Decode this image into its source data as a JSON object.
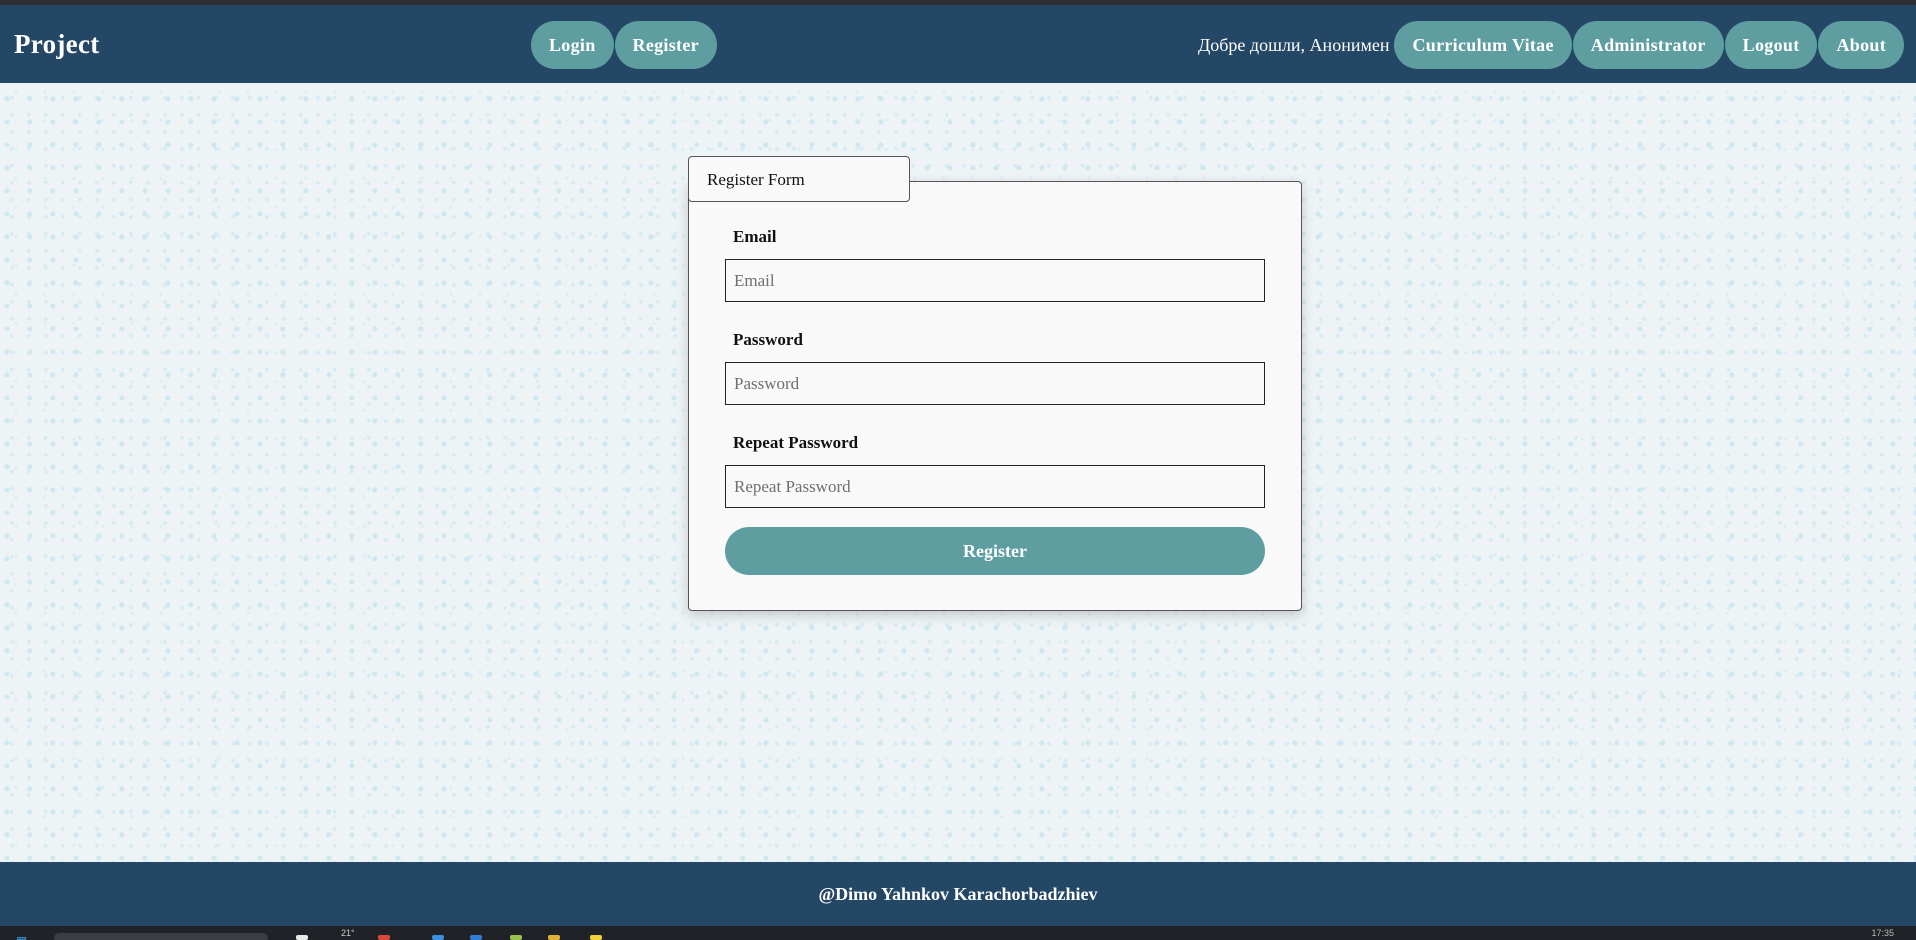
{
  "navbar": {
    "brand": "Project",
    "center_links": [
      "Login",
      "Register"
    ],
    "welcome": "Добре дошли, Анонимен",
    "right_links": [
      "Curriculum Vitae",
      "Administrator",
      "Logout",
      "About"
    ]
  },
  "form": {
    "tab_title": "Register Form",
    "email_label": "Email",
    "email_placeholder": "Email",
    "password_label": "Password",
    "password_placeholder": "Password",
    "repeat_label": "Repeat Password",
    "repeat_placeholder": "Repeat Password",
    "submit_label": "Register"
  },
  "footer": {
    "text": "@Dimo Yahnkov Karachorbadzhiev"
  },
  "taskbar": {
    "temperature": "21°",
    "clock": "17:35"
  },
  "colors": {
    "navbar": "#244766",
    "accent": "#5f9ea0",
    "page_bg": "#eef4f6",
    "card_bg": "#f9f9f9"
  }
}
